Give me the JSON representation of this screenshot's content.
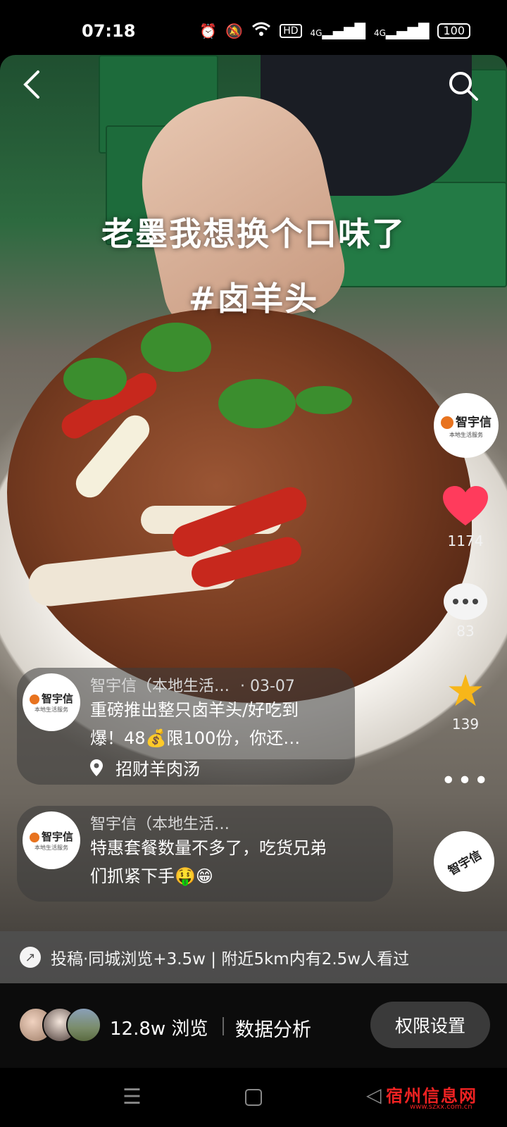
{
  "status_bar": {
    "time": "07:18",
    "icons": [
      "alarm-icon",
      "mute-icon",
      "wifi-icon",
      "hd-icon",
      "signal-4g-icon",
      "signal-4g-icon"
    ],
    "hd_label": "HD",
    "network1": "4G",
    "network2": "4G",
    "battery": "100"
  },
  "video": {
    "title_line1": "老墨我想换个口味了",
    "title_line2": "#卤羊头"
  },
  "right_rail": {
    "avatar_brand": "智宇信",
    "avatar_sub": "本地生活服务",
    "like_count": "1174",
    "comment_count": "83",
    "favorite_count": "139",
    "more_label": "•••",
    "music_brand": "智宇信"
  },
  "post_card": {
    "avatar_brand": "智宇信",
    "avatar_sub": "本地生活服务",
    "author": "智宇信（本地生活…",
    "date": "· 03-07",
    "text_line1": "重磅推出整只卤羊头/好吃到",
    "text_line2": "爆！48💰限100份，你还…",
    "location": "招财羊肉汤"
  },
  "comment_card": {
    "avatar_brand": "智宇信",
    "avatar_sub": "本地生活服务",
    "author": "智宇信（本地生活…",
    "text_line1": "特惠套餐数量不多了，吃货兄弟",
    "text_line2": "们抓紧下手🤑😁"
  },
  "stat_bar": {
    "text": "投稿·同城浏览+3.5w | 附近5km内有2.5w人看过"
  },
  "bottom_bar": {
    "views": "12.8w 浏览",
    "analysis": "数据分析",
    "permission_button": "权限设置"
  },
  "nav_bar": {
    "watermark": "宿州信息网",
    "watermark_url": "www.szxx.com.cn"
  },
  "colors": {
    "like": "#ff3b5c",
    "favorite": "#f7b619",
    "card_bg": "rgba(60,60,60,0.55)"
  }
}
